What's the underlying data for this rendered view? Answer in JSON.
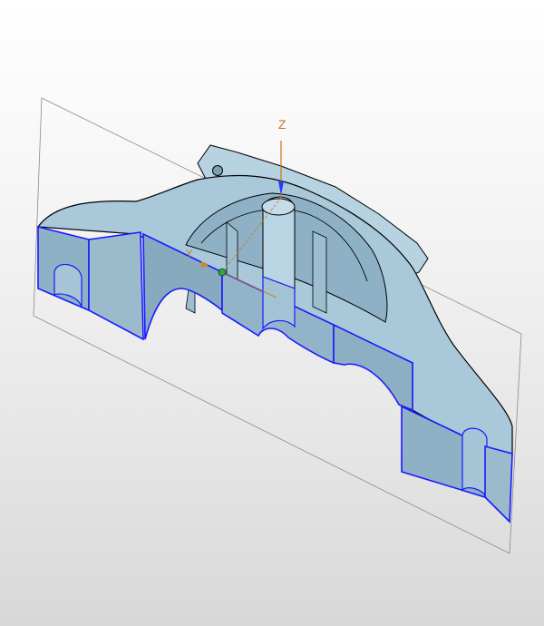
{
  "viewport": {
    "background_top": "#ffffff",
    "background_bottom": "#d8d8d8"
  },
  "part": {
    "face_color": "#a9c8d9",
    "side_color": "#8fb1c5",
    "edge_color": "#000000",
    "section_edge_color": "#1a1aff"
  },
  "section_plane": {
    "outline_color": "#8a8a8a"
  },
  "triad": {
    "z_label": "Z",
    "y_label": "Y",
    "z_color": "#c8741a",
    "y_color": "#c8741a"
  }
}
